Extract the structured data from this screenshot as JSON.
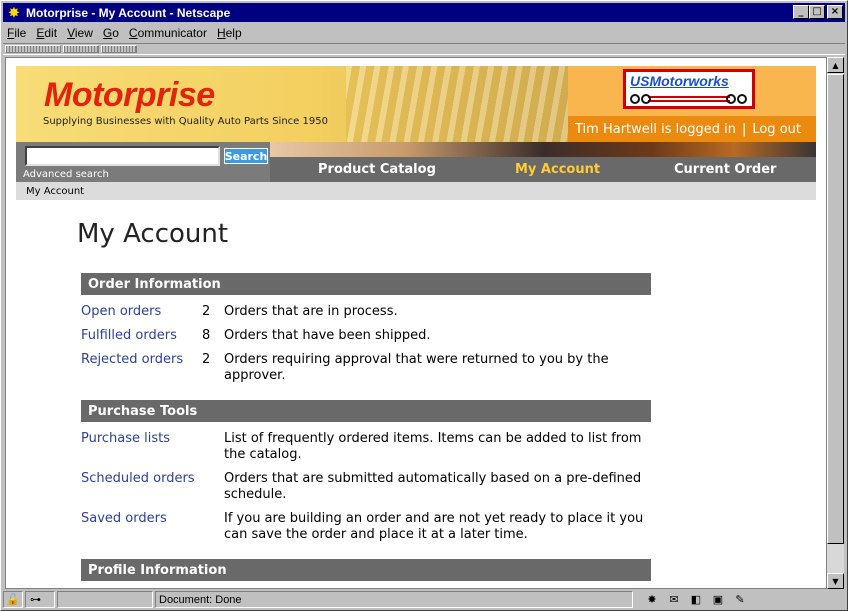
{
  "window": {
    "title": "Motorprise - My Account - Netscape",
    "buttons": {
      "minimize": "_",
      "maximize": "□",
      "close": "×"
    }
  },
  "menu": {
    "file": {
      "u": "F",
      "rest": "ile"
    },
    "edit": {
      "u": "E",
      "rest": "dit"
    },
    "view": {
      "u": "V",
      "rest": "iew"
    },
    "go": {
      "u": "G",
      "rest": "o"
    },
    "communicator": {
      "u": "C",
      "rest": "ommunicator"
    },
    "help": {
      "u": "H",
      "rest": "elp"
    }
  },
  "header": {
    "brand": "Motorprise",
    "tagline": "Supplying Businesses with Quality Auto Parts Since 1950",
    "partner": "USMotorworks",
    "login_text": "Tim Hartwell is logged in",
    "separator": "|",
    "logout": "Log out"
  },
  "search": {
    "value": "",
    "button": "Search",
    "advanced": "Advanced search"
  },
  "nav": {
    "catalog": "Product Catalog",
    "account": "My Account",
    "order": "Current Order"
  },
  "breadcrumb": "My Account",
  "page_title": "My Account",
  "sections": {
    "order_info": {
      "title": "Order Information",
      "rows": [
        {
          "label": "Open orders",
          "count": "2",
          "desc": "Orders that are in process."
        },
        {
          "label": "Fulfilled orders",
          "count": "8",
          "desc": "Orders that have been shipped."
        },
        {
          "label": "Rejected orders",
          "count": "2",
          "desc": "Orders requiring approval that were returned to you by the approver."
        }
      ]
    },
    "purchase_tools": {
      "title": "Purchase Tools",
      "rows": [
        {
          "label": "Purchase lists",
          "desc": "List of frequently ordered items. Items can be added to list from the catalog."
        },
        {
          "label": "Scheduled orders",
          "desc": "Orders that are submitted automatically based on a pre-defined schedule."
        },
        {
          "label": "Saved orders",
          "desc": "If you are building an order and are not yet ready to place it you can save the order and place it at a later time."
        }
      ]
    },
    "profile_info": {
      "title": "Profile Information"
    }
  },
  "status": {
    "text": "Document: Done"
  },
  "colors": {
    "title_bar": "#000080",
    "brand_red": "#e0240e",
    "link": "#2b3fa0",
    "nav_active": "#ffcc33",
    "section_bg": "#696969",
    "login_bg": "#eb8a0f"
  }
}
